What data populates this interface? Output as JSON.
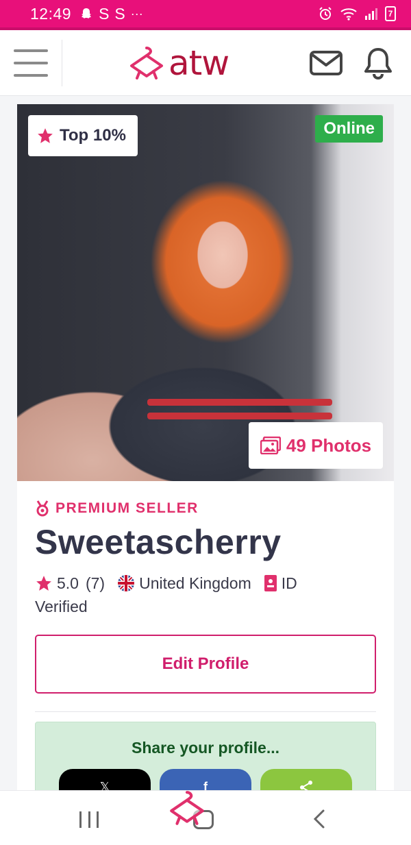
{
  "status_bar": {
    "time": "12:49",
    "notif_letters": [
      "S",
      "S"
    ],
    "more": "···",
    "battery": "7"
  },
  "header": {
    "logo_text": "atw",
    "menu_icon": "hamburger-menu-icon",
    "mail_icon": "mail-icon",
    "bell_icon": "bell-icon",
    "brand_color": "#b0153c"
  },
  "profile": {
    "badge_top": "Top 10%",
    "badge_online": "Online",
    "photos_label": "49 Photos",
    "premium_label": "PREMIUM SELLER",
    "name": "Sweetascherry",
    "rating": "5.0",
    "rating_count": "(7)",
    "country": "United Kingdom",
    "id_label": "ID",
    "verified_label": "Verified"
  },
  "actions": {
    "edit_profile": "Edit Profile"
  },
  "share": {
    "title": "Share your profile...",
    "buttons": [
      {
        "name": "x",
        "label": "𝕏",
        "color": "#000000"
      },
      {
        "name": "facebook",
        "label": "f",
        "color": "#3b64b5"
      },
      {
        "name": "share",
        "label": "<",
        "color": "#8cc63f"
      }
    ]
  },
  "colors": {
    "accent": "#e0306c",
    "status_bar": "#e8107a",
    "online": "#2eae4b"
  }
}
